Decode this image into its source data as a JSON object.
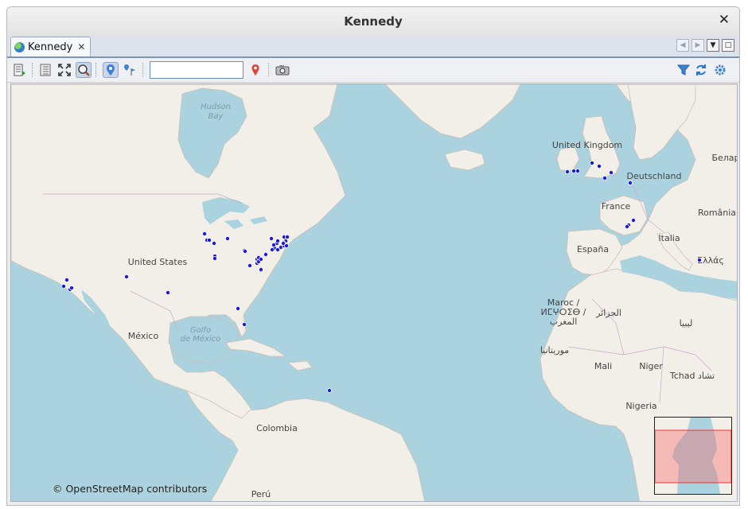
{
  "window": {
    "title": "Kennedy",
    "close_glyph": "✕"
  },
  "tab": {
    "label": "Kennedy",
    "close_glyph": "✕",
    "icon": "globe-icon"
  },
  "tabnav": {
    "prev": "◀",
    "next": "▶",
    "menu": "▼",
    "max": "□"
  },
  "toolbar": {
    "search_value": "",
    "icons": [
      "layer-list-icon",
      "layer-tree-icon",
      "fullscreen-icon",
      "zoom-icon",
      "location-pin-icon",
      "route-flag-icon",
      "red-pin-icon",
      "camera-icon",
      "filter-icon",
      "refresh-icon",
      "gear-icon"
    ]
  },
  "map": {
    "attribution": "© OpenStreetMap contributors",
    "labels": {
      "hudson": "Hudson",
      "bay": "Bay",
      "us": "United States",
      "mexico": "México",
      "golfo": "Golfo",
      "demexico": "de México",
      "colombia": "Colombia",
      "peru": "Perú",
      "uk": "United Kingdom",
      "deutschland": "Deutschland",
      "france": "France",
      "espana": "España",
      "italia": "Italia",
      "romania": "România",
      "belar": "Белар",
      "ellas": "Ελλάς",
      "maroc1": "Maroc /",
      "maroc2": "ⵍⵎⵖⵔⵉⴱ /",
      "maroc3": "المغرب",
      "algeria": "الجزائر",
      "libya": "ليبيا",
      "mauritania": "موريتانيا",
      "mali": "Mali",
      "niger": "Niger",
      "tchad": "Tchad تشاد",
      "nigeria": "Nigeria"
    },
    "marker_color": "#1a1adc"
  }
}
